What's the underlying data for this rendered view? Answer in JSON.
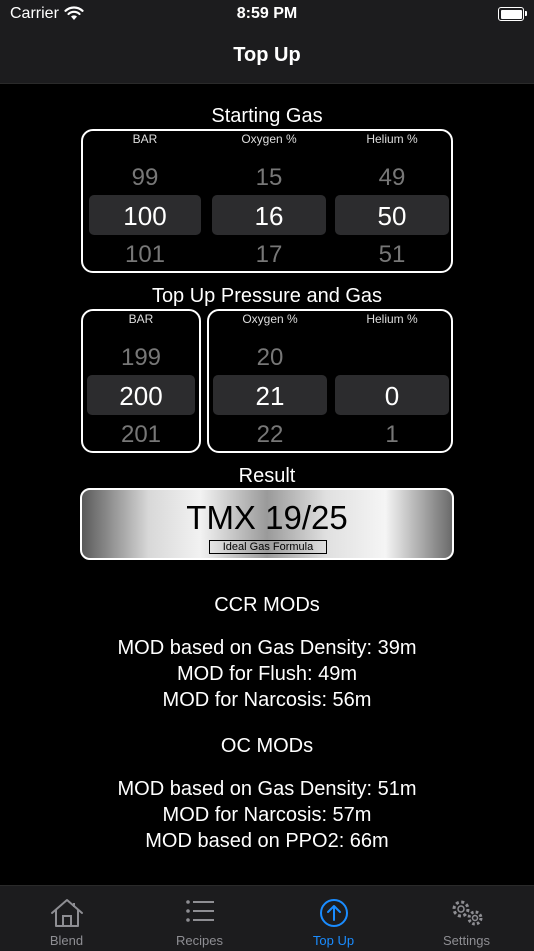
{
  "status_bar": {
    "carrier": "Carrier",
    "time": "8:59 PM"
  },
  "nav": {
    "title": "Top Up"
  },
  "starting_gas": {
    "title": "Starting Gas",
    "columns": [
      {
        "label": "BAR",
        "above": "99",
        "selected": "100",
        "below": "101"
      },
      {
        "label": "Oxygen %",
        "above": "15",
        "selected": "16",
        "below": "17"
      },
      {
        "label": "Helium %",
        "above": "49",
        "selected": "50",
        "below": "51"
      }
    ]
  },
  "top_up": {
    "title": "Top Up Pressure and Gas",
    "pressure": {
      "label": "BAR",
      "above": "199",
      "selected": "200",
      "below": "201"
    },
    "oxygen": {
      "label": "Oxygen %",
      "above": "20",
      "selected": "21",
      "below": "22"
    },
    "helium": {
      "label": "Helium %",
      "above": "",
      "selected": "0",
      "below": "1"
    }
  },
  "result": {
    "title": "Result",
    "value": "TMX 19/25",
    "formula": "Ideal Gas Formula"
  },
  "ccr": {
    "title": "CCR MODs",
    "lines": [
      "MOD based on Gas Density: 39m",
      "MOD for Flush: 49m",
      "MOD for Narcosis: 56m"
    ]
  },
  "oc": {
    "title": "OC MODs",
    "lines": [
      "MOD based on Gas Density: 51m",
      "MOD for Narcosis: 57m",
      "MOD based on PPO2: 66m"
    ]
  },
  "tabs": [
    {
      "label": "Blend",
      "icon": "house-icon",
      "active": false
    },
    {
      "label": "Recipes",
      "icon": "list-icon",
      "active": false
    },
    {
      "label": "Top Up",
      "icon": "arrow-up-circle-icon",
      "active": true
    },
    {
      "label": "Settings",
      "icon": "gears-icon",
      "active": false
    }
  ],
  "colors": {
    "accent": "#1a8cff",
    "bar_bg": "#1c1c1e",
    "selection_band": "#2c2c2e",
    "inactive_tab": "#8e8e93"
  }
}
